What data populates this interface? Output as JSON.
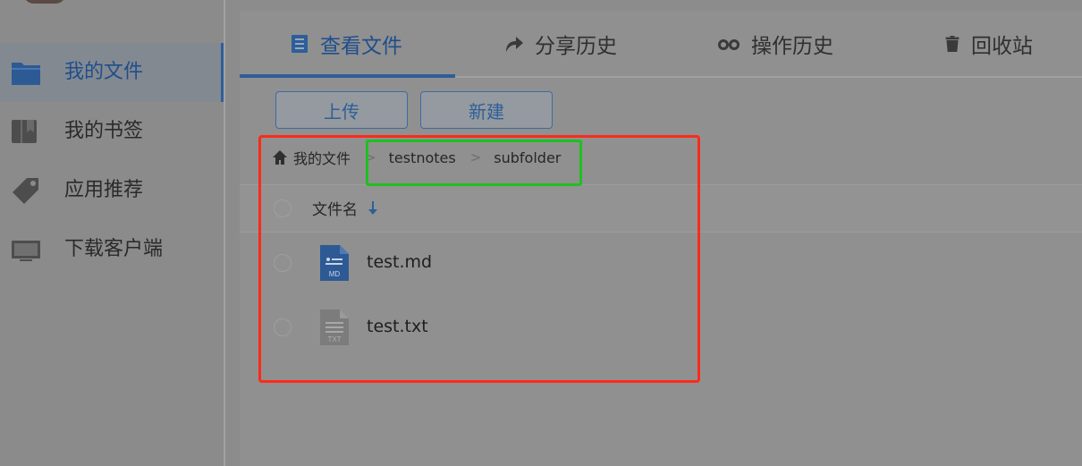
{
  "sidebar": {
    "items": [
      {
        "label": "我的文件",
        "icon": "folder-icon",
        "active": true
      },
      {
        "label": "我的书签",
        "icon": "bookmark-icon",
        "active": false
      },
      {
        "label": "应用推荐",
        "icon": "tag-icon",
        "active": false
      },
      {
        "label": "下载客户端",
        "icon": "monitor-icon",
        "active": false
      }
    ]
  },
  "tabs": [
    {
      "label": "查看文件",
      "icon": "file-list-icon",
      "active": true
    },
    {
      "label": "分享历史",
      "icon": "share-icon",
      "active": false
    },
    {
      "label": "操作历史",
      "icon": "history-icon",
      "active": false
    },
    {
      "label": "回收站",
      "icon": "trash-icon",
      "active": false
    }
  ],
  "toolbar": {
    "upload_label": "上传",
    "new_label": "新建"
  },
  "breadcrumb": {
    "root": "我的文件",
    "separator": ">",
    "segments": [
      "testnotes",
      "subfolder"
    ]
  },
  "list": {
    "header": {
      "name_column": "文件名",
      "sort": "descending"
    },
    "files": [
      {
        "name": "test.md",
        "type": "MD",
        "icon": "markdown-file-icon"
      },
      {
        "name": "test.txt",
        "type": "TXT",
        "icon": "text-file-icon"
      }
    ]
  },
  "colors": {
    "accent": "#2e5e9a",
    "annotation_red": "#ff2a1a",
    "annotation_green": "#1fbf1f"
  }
}
